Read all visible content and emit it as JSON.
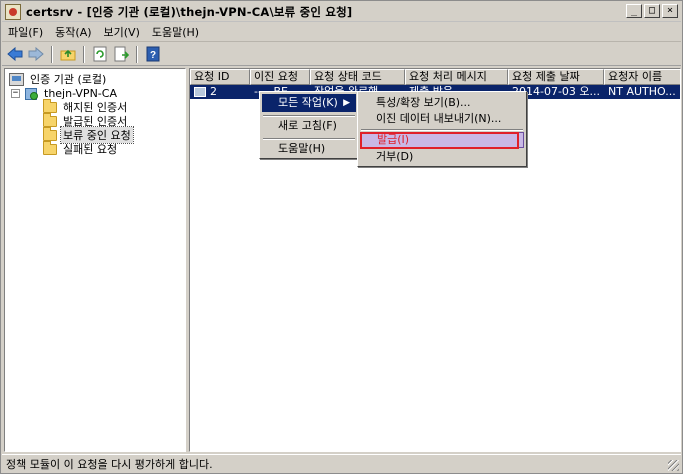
{
  "window": {
    "title": "certsrv - [인증 기관 (로컬)\\thejn-VPN-CA\\보류 중인 요청]",
    "controls": [
      "_",
      "□",
      "×"
    ]
  },
  "menubar": {
    "file": "파일(F)",
    "action": "동작(A)",
    "view": "보기(V)",
    "help": "도움말(H)"
  },
  "toolbar": {
    "icons": [
      "back-icon",
      "forward-icon",
      "up-folder-icon",
      "refresh-icon",
      "export-list-icon",
      "help-icon"
    ]
  },
  "tree": {
    "root": "인증 기관 (로컬)",
    "ca": "thejn-VPN-CA",
    "children": [
      "해지된 인증서",
      "발급된 인증서",
      "보류 중인 요청",
      "실패된 요청"
    ]
  },
  "columns": [
    "요청 ID",
    "이진 요청",
    "요청 상태 코드",
    "요청 처리 메시지",
    "요청 제출 날짜",
    "요청자 이름"
  ],
  "row": {
    "id": "2",
    "binary": "-----BE...",
    "status_code": "작업을 완료했...",
    "disposition": "제출 받음",
    "submitted": "2014-07-03 오...",
    "requester": "NT AUTHO..."
  },
  "context_menu": {
    "all_tasks": "모든 작업(K)",
    "refresh": "새로 고침(F)",
    "help": "도움말(H)"
  },
  "submenu": {
    "properties": "특성/확장 보기(B)...",
    "export_binary": "이진 데이터 내보내기(N)...",
    "issue": "발급(I)",
    "deny": "거부(D)"
  },
  "status": "정책 모듈이 이 요청을 다시 평가하게 합니다.",
  "colors": {
    "selection": "#0a246a",
    "highlight_border": "#e0202a",
    "issue_fill": "#c9b8e6"
  }
}
